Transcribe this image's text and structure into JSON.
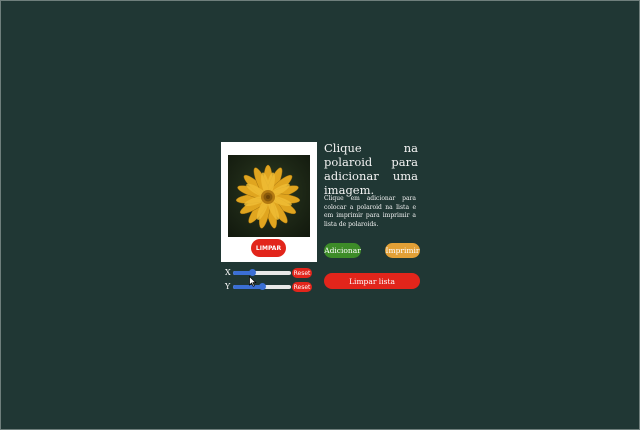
{
  "polaroid": {
    "photo_subject": "yellow-flower",
    "clear_label": "LIMPAR"
  },
  "sliders": {
    "x": {
      "label": "X",
      "value_fraction": 0.33,
      "reset_label": "Reset"
    },
    "y": {
      "label": "Y",
      "value_fraction": 0.5,
      "reset_label": "Reset"
    }
  },
  "panel": {
    "heading": "Clique na polaroid para adicionar uma imagem.",
    "description": "Clique em adicionar para colocar a polaroid na lista e em imprimir para imprimir a lista de polaroids.",
    "add_label": "Adicionar",
    "print_label": "Imprimir",
    "clear_list_label": "Limpar lista"
  },
  "colors": {
    "background": "#203734",
    "danger": "#e2251b",
    "success": "#3d8c28",
    "warning": "#e3a036",
    "slider": "#3b6fd4"
  }
}
